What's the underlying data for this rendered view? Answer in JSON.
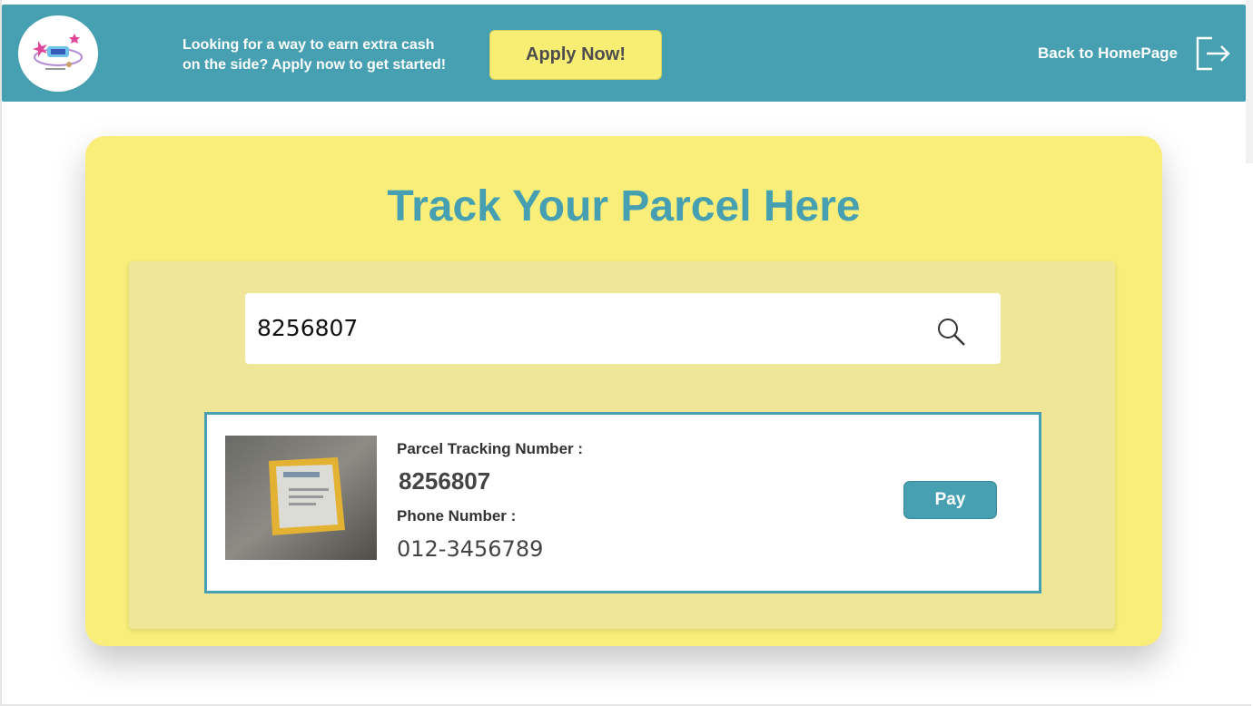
{
  "header": {
    "logo_alt": "brand-logo",
    "promo_line1": "Looking for a way to earn extra cash",
    "promo_line2": "on the side? Apply now to get started!",
    "apply_label": "Apply Now!",
    "back_label": "Back to HomePage",
    "bg_color": "#47a0b1",
    "apply_color": "#f8ee73"
  },
  "main": {
    "title": "Track Your Parcel Here",
    "search": {
      "value": "8256807",
      "icon": "search-icon"
    },
    "result": {
      "image_icon": "parcel-photo",
      "tracking_label": "Parcel Tracking Number :",
      "tracking_value": "8256807",
      "phone_label": "Phone Number :",
      "phone_value": "012-3456789",
      "pay_label": "Pay"
    },
    "card_color": "#f8ee79",
    "accent": "#47a0b1"
  }
}
